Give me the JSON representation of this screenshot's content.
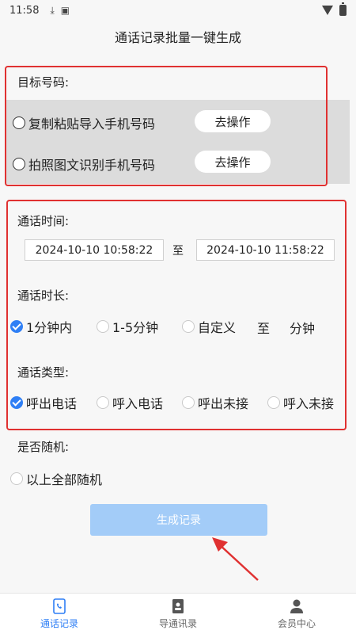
{
  "status": {
    "time": "11:58"
  },
  "title": "通话记录批量一键生成",
  "target": {
    "label": "目标号码:",
    "options": [
      {
        "label": "复制粘贴导入手机号码",
        "button": "去操作"
      },
      {
        "label": "拍照图文识别手机号码",
        "button": "去操作"
      }
    ]
  },
  "call_time": {
    "label": "通话时间:",
    "start": "2024-10-10 10:58:22",
    "to": "至",
    "end": "2024-10-10 11:58:22"
  },
  "call_duration": {
    "label": "通话时长:",
    "opt1": "1分钟内",
    "opt2": "1-5分钟",
    "opt3": "自定义",
    "to": "至",
    "unit": "分钟",
    "selected": "1分钟内"
  },
  "call_type": {
    "label": "通话类型:",
    "options": [
      "呼出电话",
      "呼入电话",
      "呼出未接",
      "呼入未接"
    ],
    "selected": "呼出电话"
  },
  "random": {
    "label": "是否随机:",
    "option": "以上全部随机"
  },
  "generate_button": "生成记录",
  "tabs": [
    {
      "label": "通话记录",
      "icon": "phone-record-icon",
      "active": true
    },
    {
      "label": "导通讯录",
      "icon": "contacts-book-icon",
      "active": false
    },
    {
      "label": "会员中心",
      "icon": "person-icon",
      "active": false
    }
  ],
  "colors": {
    "accent": "#2f7ff5",
    "highlight_border": "#e03131",
    "button_disabled": "#a3ccf8"
  }
}
